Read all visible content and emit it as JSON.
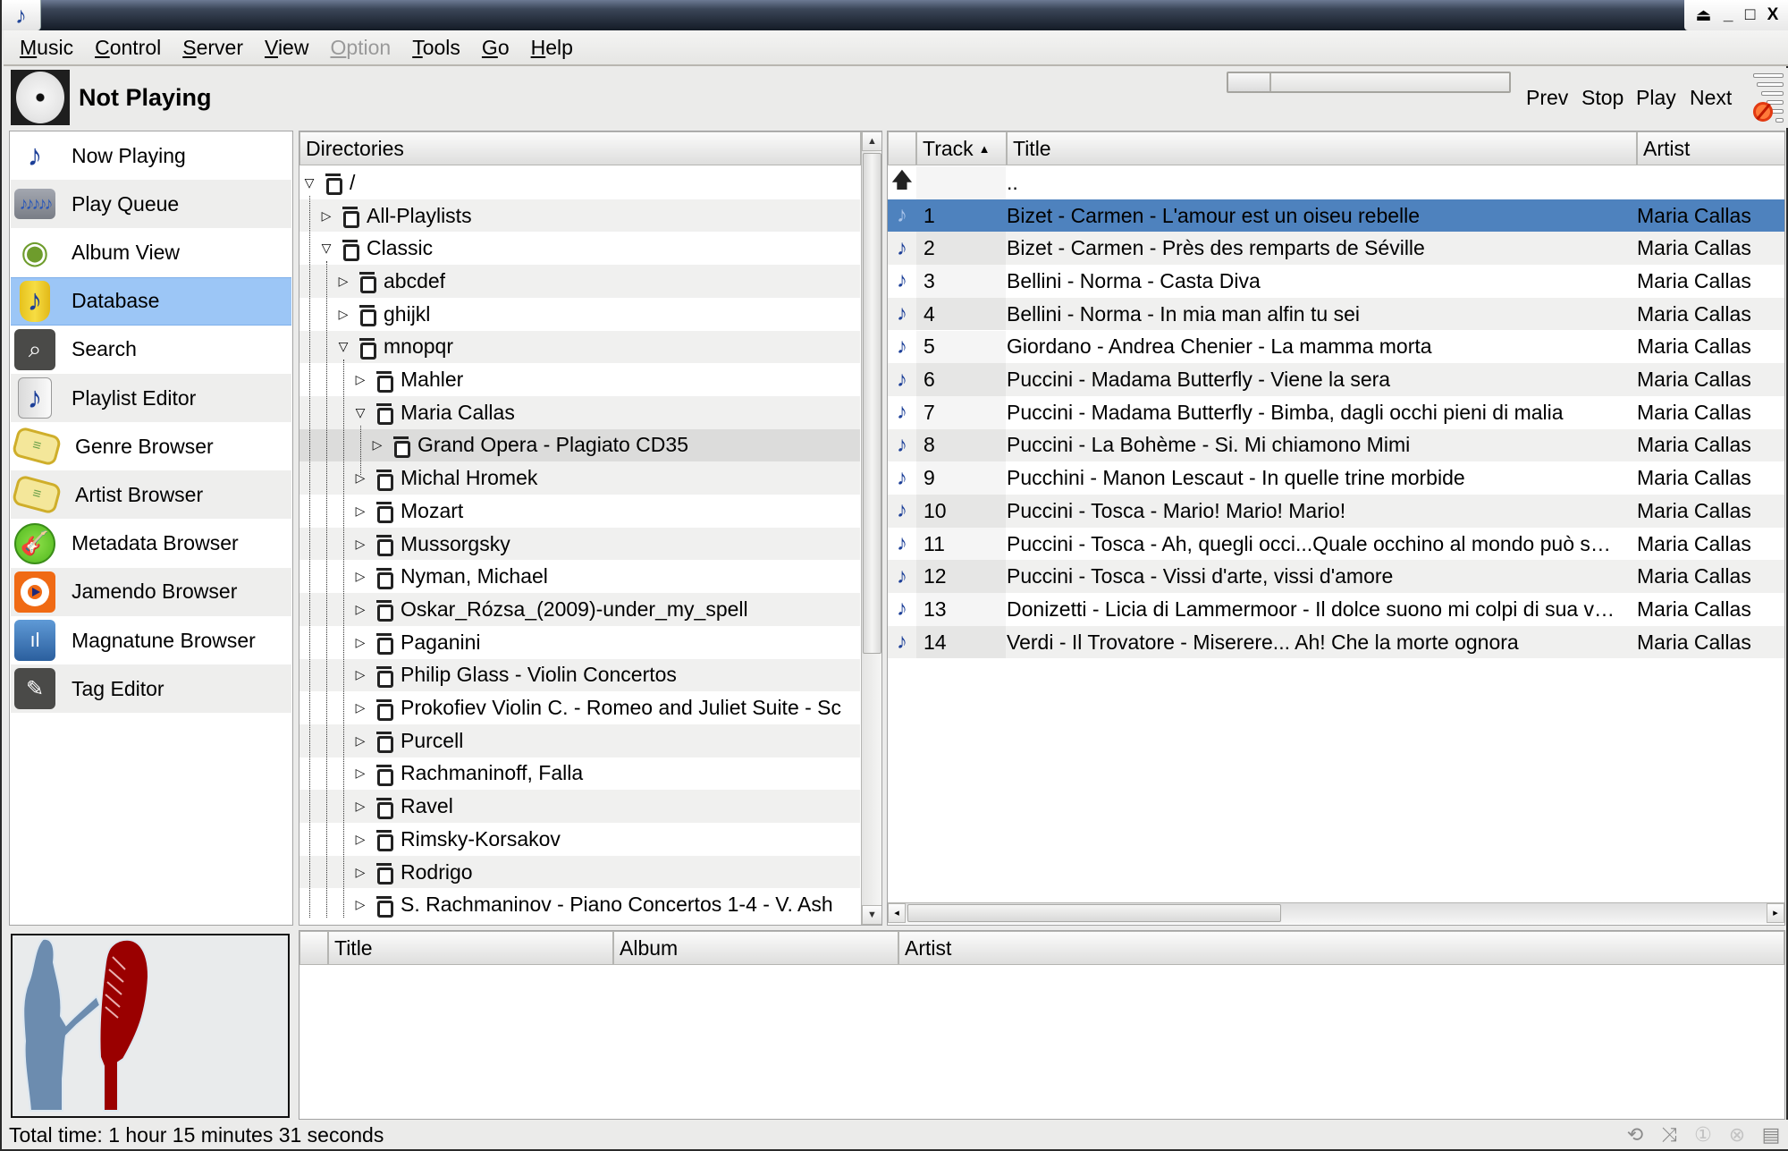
{
  "window": {
    "app_icon": "music-note-icon",
    "controls": [
      "shade",
      "minimize",
      "maximize",
      "close"
    ],
    "control_glyphs": [
      "⏏",
      "_",
      "□",
      "X"
    ]
  },
  "menu": [
    {
      "label": "Music",
      "mnemonic": "M",
      "rest": "usic",
      "enabled": true
    },
    {
      "label": "Control",
      "mnemonic": "C",
      "rest": "ontrol",
      "enabled": true
    },
    {
      "label": "Server",
      "mnemonic": "S",
      "rest": "erver",
      "enabled": true
    },
    {
      "label": "View",
      "mnemonic": "V",
      "rest": "iew",
      "enabled": true
    },
    {
      "label": "Option",
      "mnemonic": "O",
      "rest": "ption",
      "enabled": false
    },
    {
      "label": "Tools",
      "mnemonic": "T",
      "rest": "ools",
      "enabled": true
    },
    {
      "label": "Go",
      "mnemonic": "G",
      "rest": "o",
      "enabled": true
    },
    {
      "label": "Help",
      "mnemonic": "H",
      "rest": "elp",
      "enabled": true
    }
  ],
  "toolbar": {
    "status": "Not Playing",
    "seek_progress_percent": 0,
    "prev": "Prev",
    "stop": "Stop",
    "play": "Play",
    "next": "Next",
    "volume_muted": true
  },
  "sidebar": {
    "selected_index": 3,
    "items": [
      {
        "label": "Now Playing",
        "icon": "now-playing-icon",
        "glyph": "♪"
      },
      {
        "label": "Play Queue",
        "icon": "play-queue-icon",
        "glyph": "♪♪♪♪♪"
      },
      {
        "label": "Album View",
        "icon": "album-view-icon",
        "glyph": "◉"
      },
      {
        "label": "Database",
        "icon": "database-icon",
        "glyph": "♪"
      },
      {
        "label": "Search",
        "icon": "search-icon",
        "glyph": "⌕"
      },
      {
        "label": "Playlist Editor",
        "icon": "playlist-editor-icon",
        "glyph": "♪"
      },
      {
        "label": "Genre Browser",
        "icon": "genre-tag-icon",
        "glyph": "≡"
      },
      {
        "label": "Artist Browser",
        "icon": "artist-tag-icon",
        "glyph": "≡"
      },
      {
        "label": "Metadata Browser",
        "icon": "guitar-icon",
        "glyph": "🎸"
      },
      {
        "label": "Jamendo Browser",
        "icon": "jamendo-icon",
        "glyph": ""
      },
      {
        "label": "Magnatune Browser",
        "icon": "magnatune-icon",
        "glyph": "ıl"
      },
      {
        "label": "Tag Editor",
        "icon": "pencil-icon",
        "glyph": "✎"
      }
    ]
  },
  "directories": {
    "header": "Directories",
    "rows": [
      {
        "label": "/",
        "depth": 0,
        "expanded": true
      },
      {
        "label": "All-Playlists",
        "depth": 1,
        "expanded": false
      },
      {
        "label": "Classic",
        "depth": 1,
        "expanded": true
      },
      {
        "label": "abcdef",
        "depth": 2,
        "expanded": false
      },
      {
        "label": "ghijkl",
        "depth": 2,
        "expanded": false
      },
      {
        "label": "mnopqr",
        "depth": 2,
        "expanded": true
      },
      {
        "label": "Mahler",
        "depth": 3,
        "expanded": false
      },
      {
        "label": "Maria Callas",
        "depth": 3,
        "expanded": true
      },
      {
        "label": "Grand Opera - Plagiato CD35",
        "depth": 4,
        "expanded": false,
        "selected": true
      },
      {
        "label": "Michal Hromek",
        "depth": 3,
        "expanded": false
      },
      {
        "label": "Mozart",
        "depth": 3,
        "expanded": false
      },
      {
        "label": "Mussorgsky",
        "depth": 3,
        "expanded": false
      },
      {
        "label": "Nyman, Michael",
        "depth": 3,
        "expanded": false
      },
      {
        "label": "Oskar_Rózsa_(2009)-under_my_spell",
        "depth": 3,
        "expanded": false
      },
      {
        "label": "Paganini",
        "depth": 3,
        "expanded": false
      },
      {
        "label": "Philip Glass - Violin Concertos",
        "depth": 3,
        "expanded": false
      },
      {
        "label": "Prokofiev Violin C. - Romeo and Juliet Suite - Sc",
        "depth": 3,
        "expanded": false
      },
      {
        "label": "Purcell",
        "depth": 3,
        "expanded": false
      },
      {
        "label": "Rachmaninoff, Falla",
        "depth": 3,
        "expanded": false
      },
      {
        "label": "Ravel",
        "depth": 3,
        "expanded": false
      },
      {
        "label": "Rimsky-Korsakov",
        "depth": 3,
        "expanded": false
      },
      {
        "label": "Rodrigo",
        "depth": 3,
        "expanded": false
      },
      {
        "label": "S. Rachmaninov - Piano Concertos 1-4 - V. Ash",
        "depth": 3,
        "expanded": false
      }
    ]
  },
  "tracks": {
    "columns": {
      "track": "Track",
      "title": "Title",
      "artist": "Artist"
    },
    "sort_column": "Track",
    "sort_direction": "ascending",
    "parent_row": {
      "title": ".."
    },
    "rows": [
      {
        "track": "1",
        "title": "Bizet - Carmen - L'amour est un oiseu rebelle",
        "artist": "Maria Callas",
        "selected": true
      },
      {
        "track": "2",
        "title": "Bizet - Carmen - Près des remparts de Séville",
        "artist": "Maria Callas"
      },
      {
        "track": "3",
        "title": "Bellini - Norma - Casta Diva",
        "artist": "Maria Callas"
      },
      {
        "track": "4",
        "title": "Bellini - Norma - In mia man alfin tu sei",
        "artist": "Maria Callas"
      },
      {
        "track": "5",
        "title": "Giordano - Andrea Chenier - La mamma morta",
        "artist": "Maria Callas"
      },
      {
        "track": "6",
        "title": "Puccini - Madama Butterfly - Viene la sera",
        "artist": "Maria Callas"
      },
      {
        "track": "7",
        "title": "Puccini - Madama Butterfly - Bimba, dagli occhi pieni di malia",
        "artist": "Maria Callas"
      },
      {
        "track": "8",
        "title": "Puccini - La Bohème - Si. Mi chiamono Mimi",
        "artist": "Maria Callas"
      },
      {
        "track": "9",
        "title": "Pucchini - Manon Lescaut - In quelle trine morbide",
        "artist": "Maria Callas"
      },
      {
        "track": "10",
        "title": "Puccini - Tosca - Mario! Mario! Mario!",
        "artist": "Maria Callas"
      },
      {
        "track": "11",
        "title": "Puccini - Tosca - Ah, quegli occi...Quale occhino al mondo può s…",
        "artist": "Maria Callas"
      },
      {
        "track": "12",
        "title": "Puccini - Tosca - Vissi d'arte, vissi d'amore",
        "artist": "Maria Callas"
      },
      {
        "track": "13",
        "title": "Donizetti - Licia di Lammermoor - Il dolce suono mi colpi di sua v…",
        "artist": "Maria Callas"
      },
      {
        "track": "14",
        "title": "Verdi - Il Trovatore - Miserere... Ah! Che la morte ognora",
        "artist": "Maria Callas"
      }
    ]
  },
  "lower_pane": {
    "columns": {
      "title": "Title",
      "album": "Album",
      "artist": "Artist"
    }
  },
  "album_art": {
    "description": "default artist placeholder: singer silhouette and red microphone"
  },
  "statusbar": {
    "total_time": "Total time: 1 hour 15 minutes 31 seconds",
    "icons": [
      "repeat-icon",
      "shuffle-icon",
      "single-icon",
      "consume-icon",
      "playlist-icon"
    ]
  },
  "colors": {
    "selection": "#4e82be",
    "sidebar_selection": "#9cc6f6",
    "accent_note": "#1c3f98",
    "mic_red": "#9a0000",
    "silhouette_blue": "#6c8caf"
  }
}
